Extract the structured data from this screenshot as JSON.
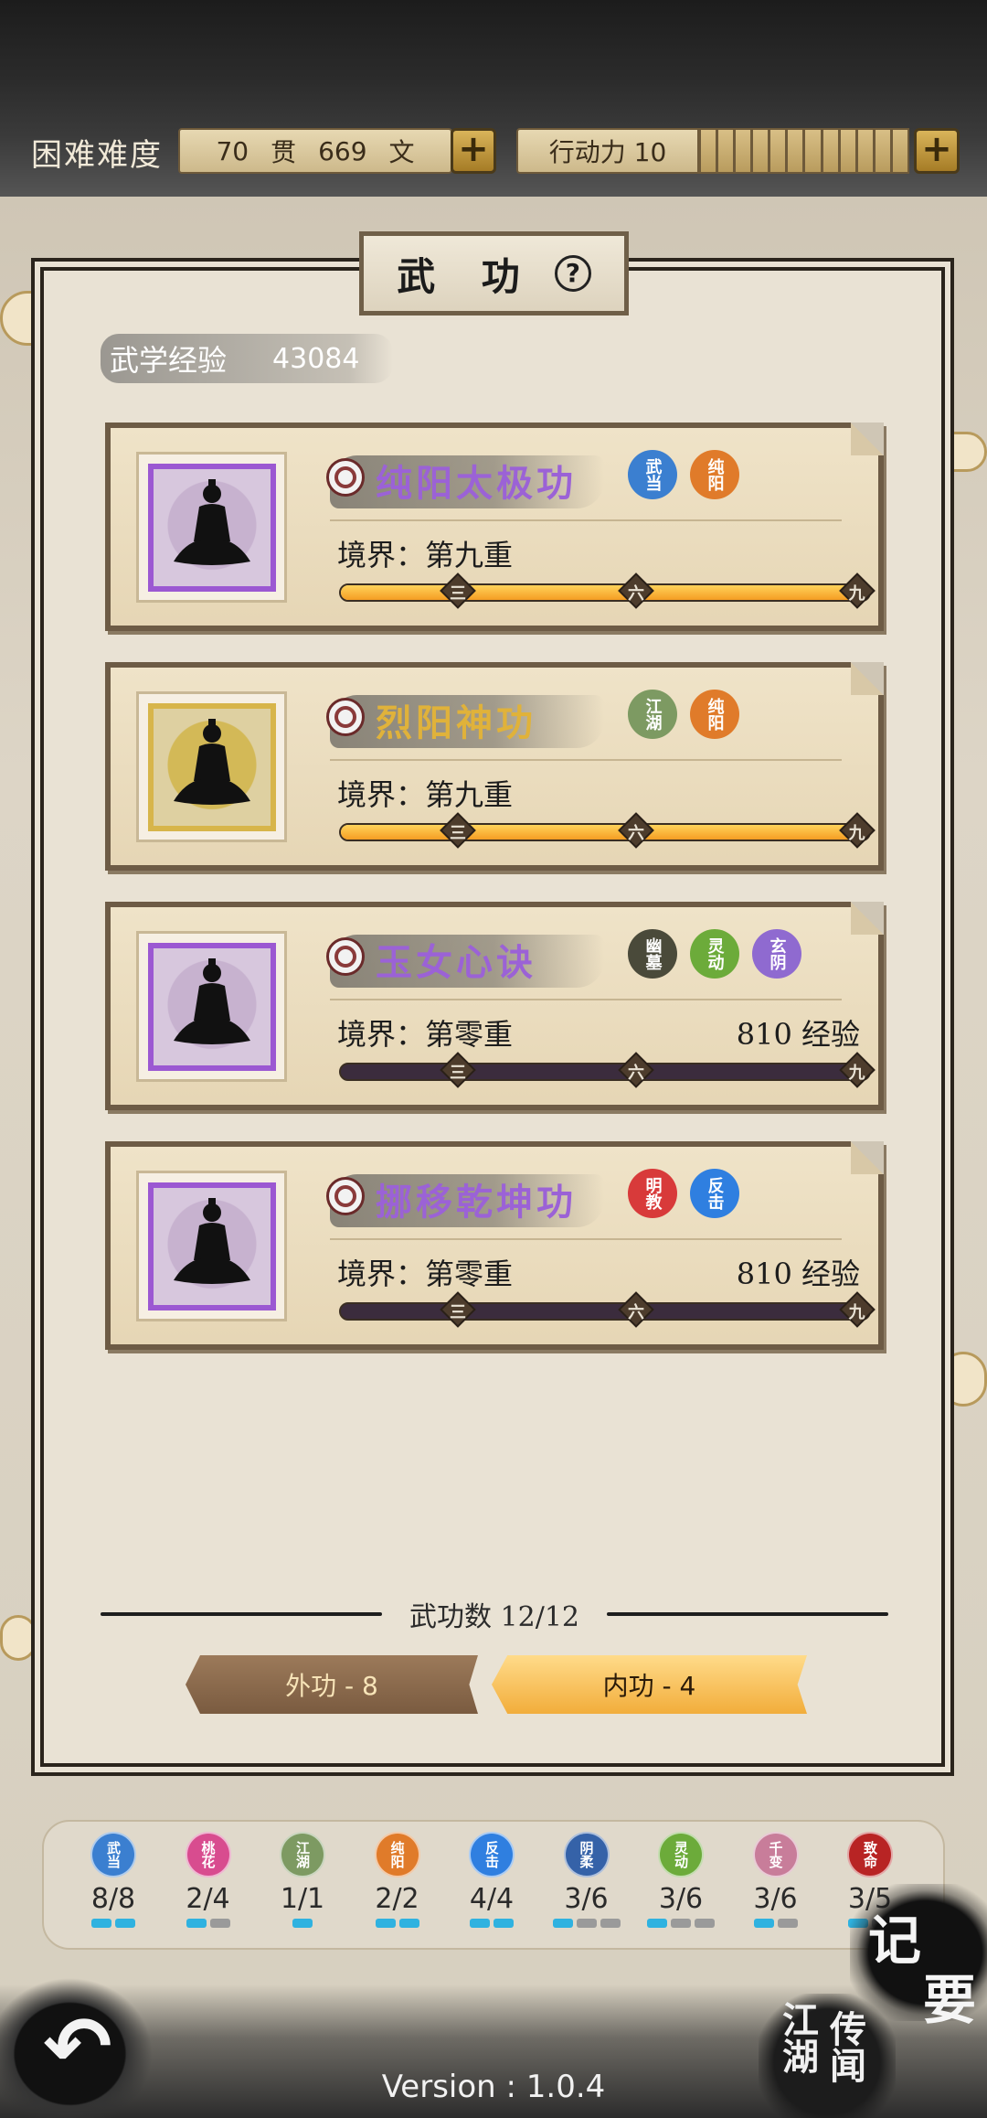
{
  "header": {
    "difficulty": "困难难度",
    "money_guan": "70",
    "money_guan_unit": "贯",
    "money_wen": "669",
    "money_wen_unit": "文",
    "action_power": "行动力 10",
    "action_cells": 12
  },
  "panel": {
    "title": "武 功",
    "help": "?",
    "exp_label": "武学经验",
    "exp_value": "43084"
  },
  "skills": [
    {
      "name": "纯阳太极功",
      "color": "purple",
      "tags": [
        "武当",
        "纯阳"
      ],
      "realm": "境界：第九重",
      "exp_need": "",
      "progress": 1.0
    },
    {
      "name": "烈阳神功",
      "color": "gold",
      "tags": [
        "江湖",
        "纯阳"
      ],
      "realm": "境界：第九重",
      "exp_need": "",
      "progress": 1.0
    },
    {
      "name": "玉女心诀",
      "color": "purple",
      "tags": [
        "幽墓",
        "灵动",
        "玄阴"
      ],
      "realm": "境界：第零重",
      "exp_need": "810 经验",
      "progress": 0
    },
    {
      "name": "挪移乾坤功",
      "color": "purple",
      "tags": [
        "明教",
        "反击"
      ],
      "realm": "境界：第零重",
      "exp_need": "810 经验",
      "progress": 0
    }
  ],
  "bar_markers": [
    "三",
    "六",
    "九"
  ],
  "footer": {
    "count": "武功数 12/12",
    "tab_outer": "外功 - 8",
    "tab_inner": "内功 - 4"
  },
  "sects": [
    {
      "name": "武当",
      "count": "8/8",
      "color": "#3b7fd0",
      "pips": [
        1,
        1
      ]
    },
    {
      "name": "桃花",
      "count": "2/4",
      "color": "#d84c8f",
      "pips": [
        1,
        0
      ]
    },
    {
      "name": "江湖",
      "count": "1/1",
      "color": "#7d9a62",
      "pips": [
        1
      ]
    },
    {
      "name": "纯阳",
      "count": "2/2",
      "color": "#e07b2a",
      "pips": [
        1,
        1
      ]
    },
    {
      "name": "反击",
      "count": "4/4",
      "color": "#2f7fe0",
      "pips": [
        1,
        1
      ]
    },
    {
      "name": "阴柔",
      "count": "3/6",
      "color": "#3562a8",
      "pips": [
        1,
        0,
        0
      ]
    },
    {
      "name": "灵动",
      "count": "3/6",
      "color": "#6cab3a",
      "pips": [
        1,
        0,
        0
      ]
    },
    {
      "name": "千变",
      "count": "3/6",
      "color": "#c87d9a",
      "pips": [
        1,
        0
      ]
    },
    {
      "name": "致命",
      "count": "3/5",
      "color": "#b82424",
      "pips": [
        1,
        0
      ]
    }
  ],
  "tag_colors": {
    "武当": "#3b7fd0",
    "纯阳": "#e07b2a",
    "江湖": "#7d9a62",
    "幽墓": "#4a4a3a",
    "灵动": "#6cab3a",
    "玄阴": "#8f6ad0",
    "明教": "#d83a3a",
    "反击": "#2f7fe0"
  },
  "bottom": {
    "memo_1": "记",
    "memo_2": "要",
    "rumor_1": "江湖",
    "rumor_2": "传闻",
    "version": "Version : 1.0.4"
  }
}
